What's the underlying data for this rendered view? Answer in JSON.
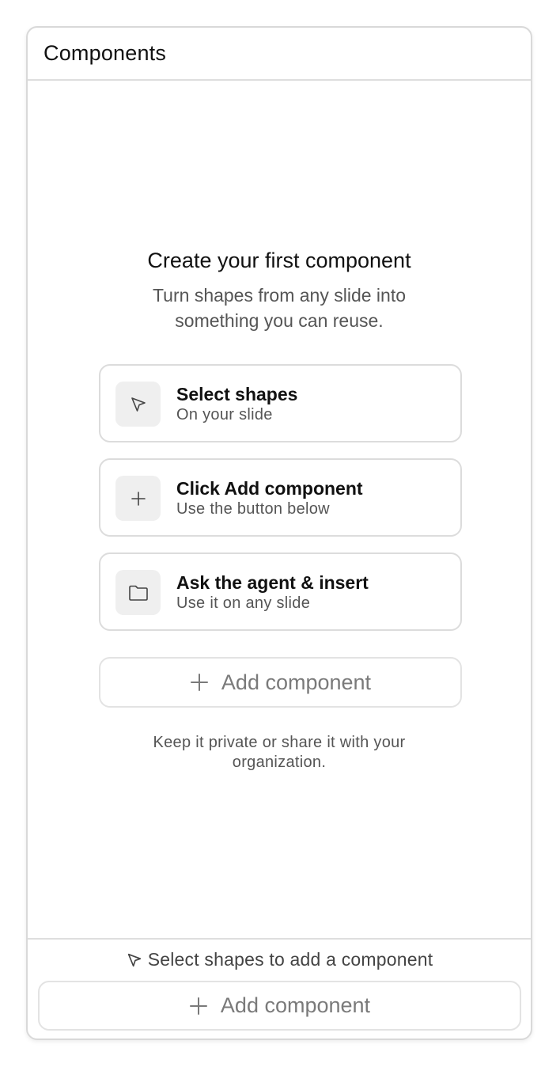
{
  "panel": {
    "title": "Components"
  },
  "empty_state": {
    "title": "Create your first component",
    "subtitle": "Turn shapes from any slide into something you can reuse.",
    "steps": [
      {
        "icon": "cursor-arrow-icon",
        "title": "Select shapes",
        "subtitle": "On your slide"
      },
      {
        "icon": "plus-icon",
        "title": "Click Add component",
        "subtitle": "Use the button below"
      },
      {
        "icon": "folder-icon",
        "title": "Ask the agent & insert",
        "subtitle": "Use it on any slide"
      }
    ],
    "add_button_label": "Add component",
    "privacy_note": "Keep it private or share it with your organization."
  },
  "footer": {
    "hint_icon": "cursor-arrow-icon",
    "hint": "Select shapes to add a component",
    "add_button_label": "Add component"
  },
  "colors": {
    "border": "#d9d9d9",
    "icon_tile": "#efefef",
    "muted_text": "#555555",
    "button_text": "#7a7a7a"
  }
}
